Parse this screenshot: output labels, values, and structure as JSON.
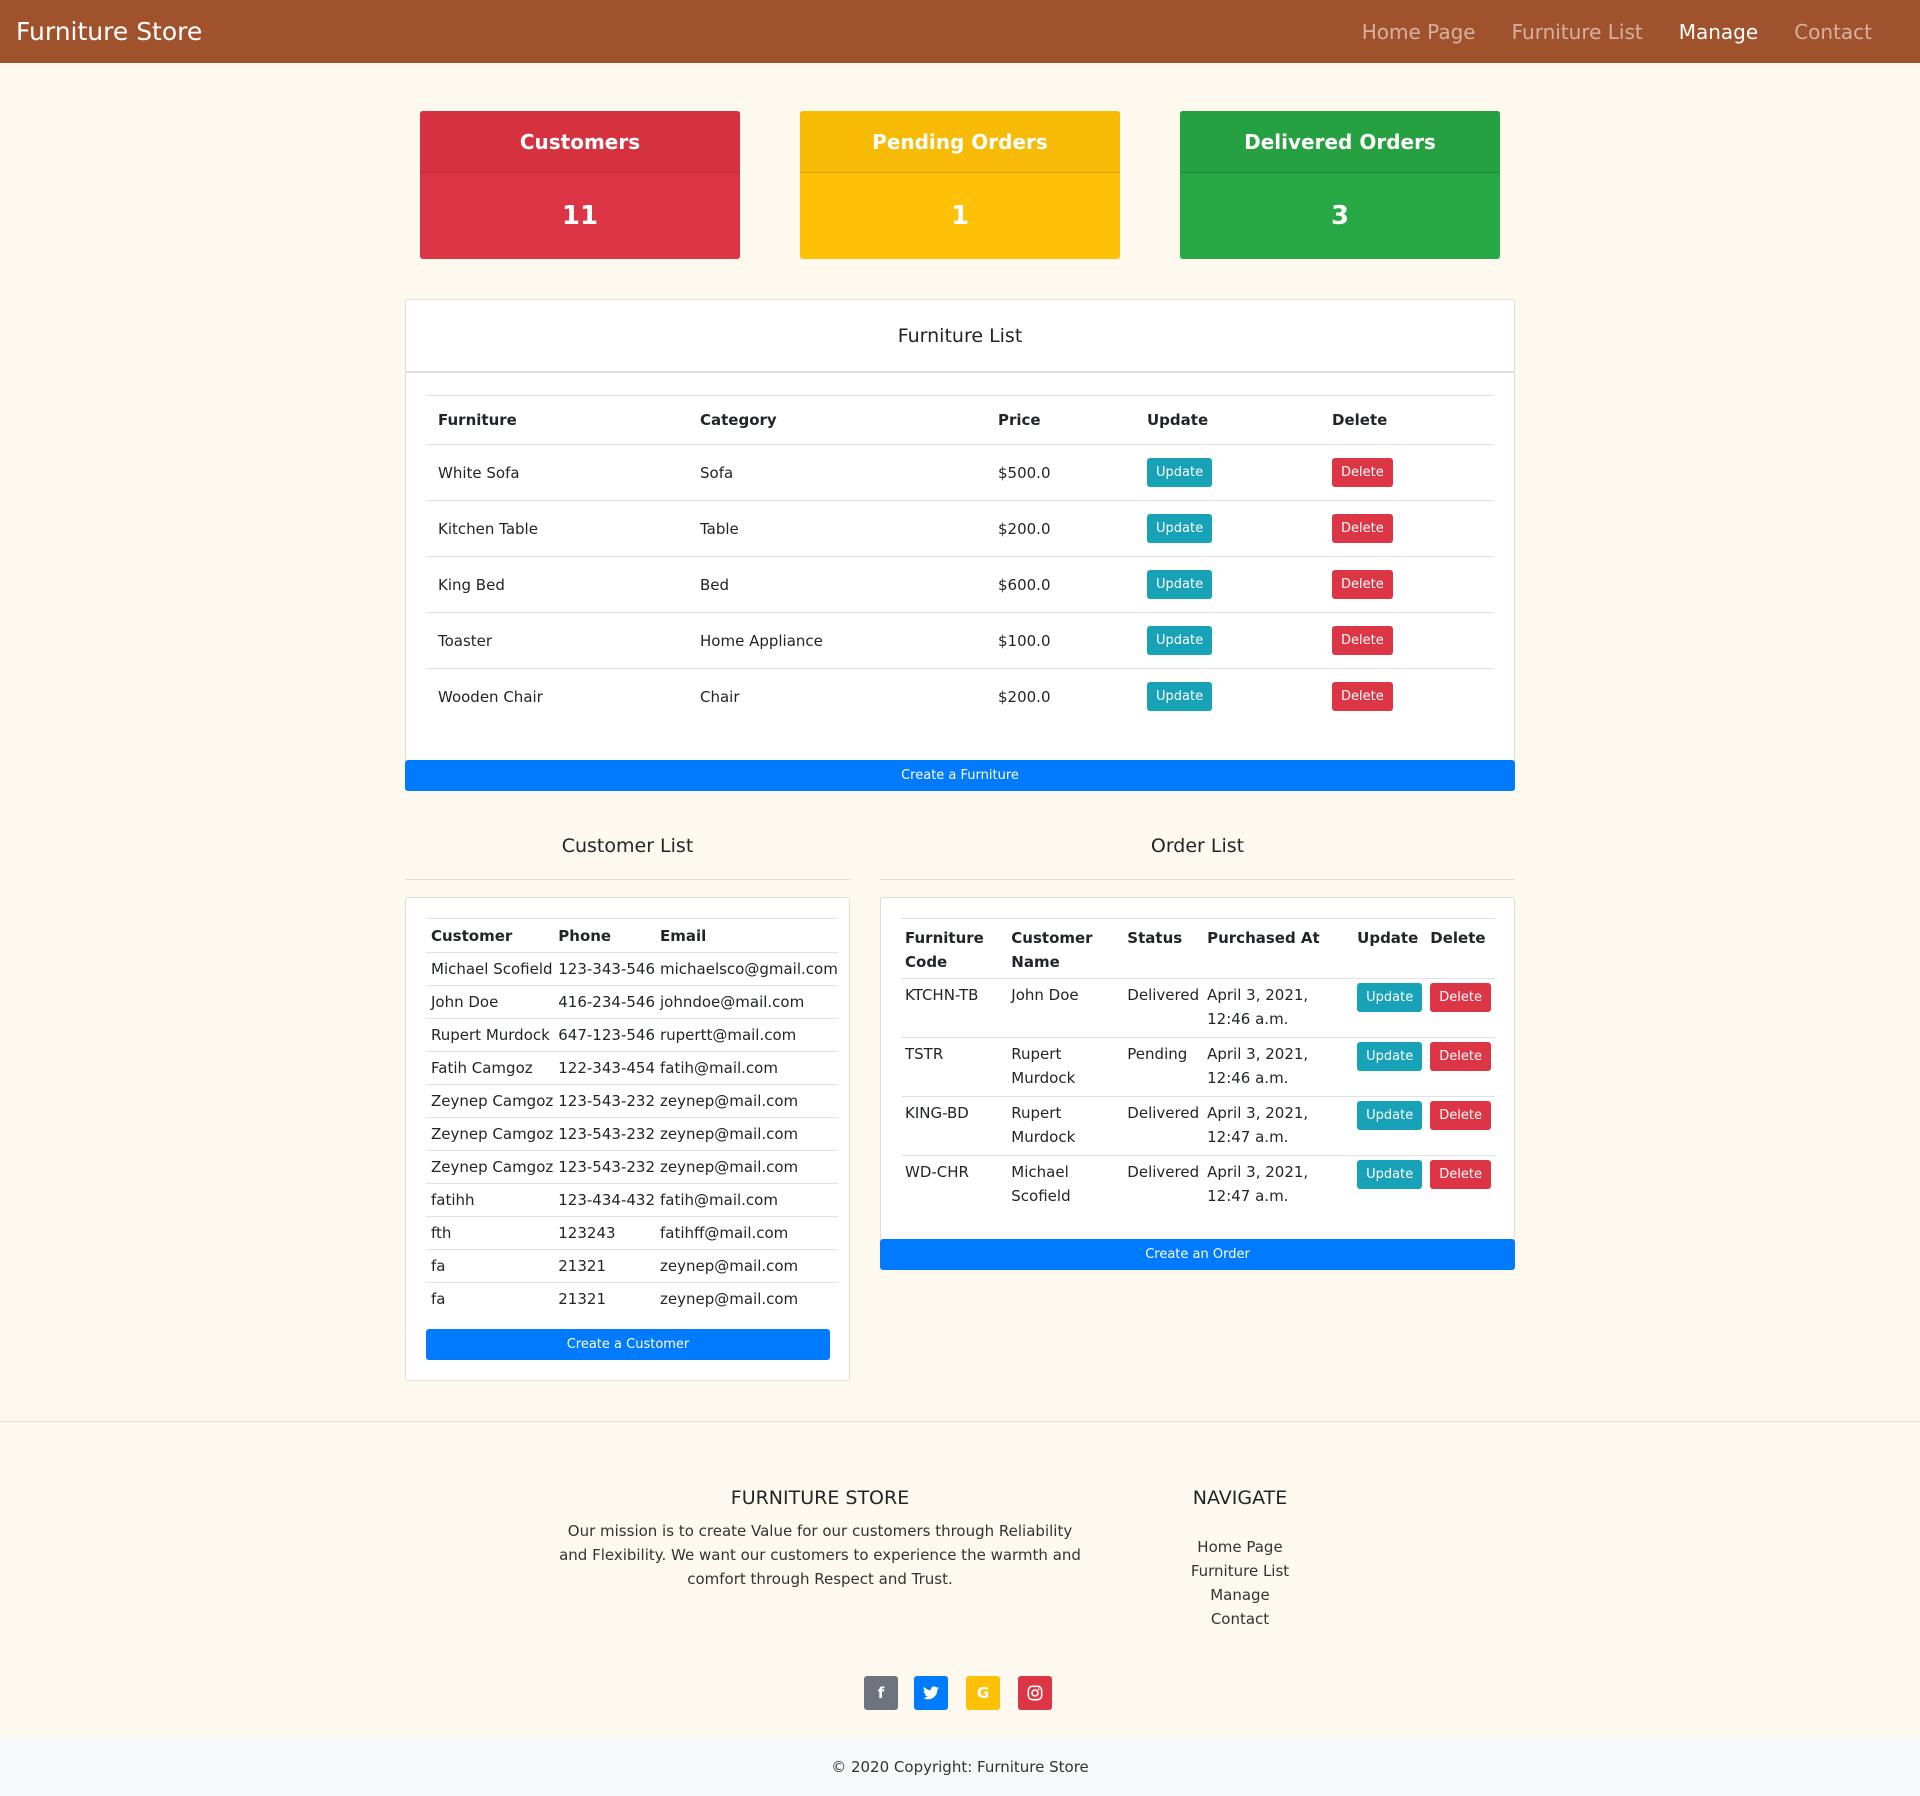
{
  "navbar": {
    "brand": "Furniture Store",
    "links": [
      "Home Page",
      "Furniture List",
      "Manage",
      "Contact"
    ]
  },
  "stats": {
    "customers": {
      "label": "Customers",
      "value": "11",
      "color": "#dc3545"
    },
    "pending": {
      "label": "Pending Orders",
      "value": "1",
      "color": "#ffc107"
    },
    "delivered": {
      "label": "Delivered Orders",
      "value": "3",
      "color": "#28a745"
    }
  },
  "furniture": {
    "title": "Furniture List",
    "headers": [
      "Furniture",
      "Category",
      "Price",
      "Update",
      "Delete"
    ],
    "rows": [
      {
        "name": "White Sofa",
        "category": "Sofa",
        "price": "$500.0"
      },
      {
        "name": "Kitchen Table",
        "category": "Table",
        "price": "$200.0"
      },
      {
        "name": "King Bed",
        "category": "Bed",
        "price": "$600.0"
      },
      {
        "name": "Toaster",
        "category": "Home Appliance",
        "price": "$100.0"
      },
      {
        "name": "Wooden Chair",
        "category": "Chair",
        "price": "$200.0"
      }
    ],
    "update_label": "Update",
    "delete_label": "Delete",
    "create_label": "Create a Furniture"
  },
  "customers": {
    "title": "Customer List",
    "headers": [
      "Customer",
      "Phone",
      "Email"
    ],
    "rows": [
      {
        "name": "Michael Scofield",
        "phone": "123-343-546",
        "email": "michaelsco@gmail.com"
      },
      {
        "name": "John Doe",
        "phone": "416-234-546",
        "email": "johndoe@mail.com"
      },
      {
        "name": "Rupert Murdock",
        "phone": "647-123-546",
        "email": "rupertt@mail.com"
      },
      {
        "name": "Fatih Camgoz",
        "phone": "122-343-454",
        "email": "fatih@mail.com"
      },
      {
        "name": "Zeynep Camgoz",
        "phone": "123-543-232",
        "email": "zeynep@mail.com"
      },
      {
        "name": "Zeynep Camgoz",
        "phone": "123-543-232",
        "email": "zeynep@mail.com"
      },
      {
        "name": "Zeynep Camgoz",
        "phone": "123-543-232",
        "email": "zeynep@mail.com"
      },
      {
        "name": "fatihh",
        "phone": "123-434-432",
        "email": "fatih@mail.com"
      },
      {
        "name": "fth",
        "phone": "123243",
        "email": "fatihff@mail.com"
      },
      {
        "name": "fa",
        "phone": "21321",
        "email": "zeynep@mail.com"
      },
      {
        "name": "fa",
        "phone": "21321",
        "email": "zeynep@mail.com"
      }
    ],
    "create_label": "Create a Customer"
  },
  "orders": {
    "title": "Order List",
    "headers": [
      "Furniture Code",
      "Customer Name",
      "Status",
      "Purchased At",
      "Update",
      "Delete"
    ],
    "rows": [
      {
        "code": "KTCHN-TB",
        "customer": "John Doe",
        "status": "Delivered",
        "purchased": "April 3, 2021, 12:46 a.m."
      },
      {
        "code": "TSTR",
        "customer": "Rupert Murdock",
        "status": "Pending",
        "purchased": "April 3, 2021, 12:46 a.m."
      },
      {
        "code": "KING-BD",
        "customer": "Rupert Murdock",
        "status": "Delivered",
        "purchased": "April 3, 2021, 12:47 a.m."
      },
      {
        "code": "WD-CHR",
        "customer": "Michael Scofield",
        "status": "Delivered",
        "purchased": "April 3, 2021, 12:47 a.m."
      }
    ],
    "update_label": "Update",
    "delete_label": "Delete",
    "create_label": "Create an Order"
  },
  "footer": {
    "about_title": "FURNITURE STORE",
    "about_text": "Our mission is to create Value for our customers through Reliability and Flexibility. We want our customers to experience the warmth and comfort through Respect and Trust.",
    "nav_title": "NAVIGATE",
    "nav_links": [
      "Home Page",
      "Furniture List",
      "Manage",
      "Contact"
    ],
    "social": [
      {
        "icon": "facebook-icon",
        "glyph": "f",
        "color": "#6c757d"
      },
      {
        "icon": "twitter-icon",
        "glyph": "🐦",
        "color": "#007bff"
      },
      {
        "icon": "google-icon",
        "glyph": "G",
        "color": "#ffc107"
      },
      {
        "icon": "instagram-icon",
        "glyph": "◎",
        "color": "#dc3545"
      }
    ],
    "copyright": "© 2020 Copyright: Furniture Store"
  }
}
